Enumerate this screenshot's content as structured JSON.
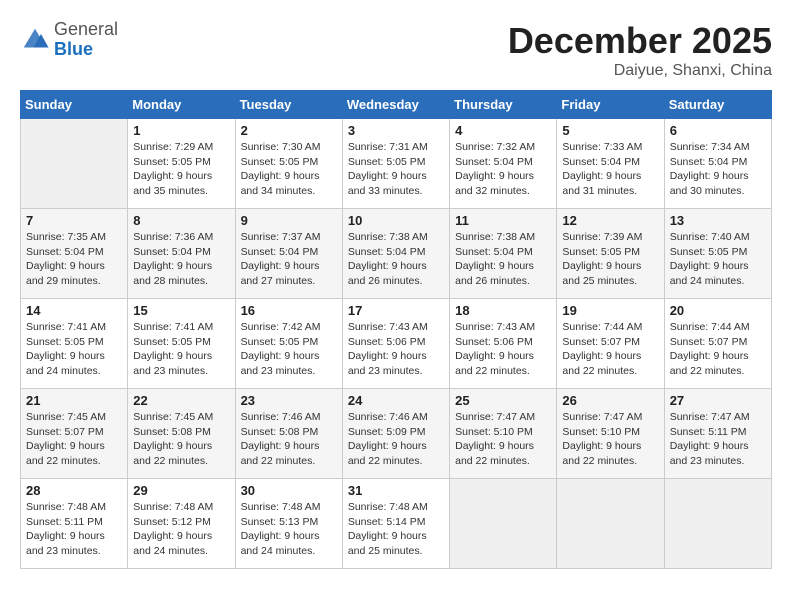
{
  "header": {
    "logo_general": "General",
    "logo_blue": "Blue",
    "month_year": "December 2025",
    "location": "Daiyue, Shanxi, China"
  },
  "days_of_week": [
    "Sunday",
    "Monday",
    "Tuesday",
    "Wednesday",
    "Thursday",
    "Friday",
    "Saturday"
  ],
  "weeks": [
    [
      {
        "day": "",
        "sunrise": "",
        "sunset": "",
        "daylight": "",
        "empty": true
      },
      {
        "day": "1",
        "sunrise": "Sunrise: 7:29 AM",
        "sunset": "Sunset: 5:05 PM",
        "daylight": "Daylight: 9 hours and 35 minutes."
      },
      {
        "day": "2",
        "sunrise": "Sunrise: 7:30 AM",
        "sunset": "Sunset: 5:05 PM",
        "daylight": "Daylight: 9 hours and 34 minutes."
      },
      {
        "day": "3",
        "sunrise": "Sunrise: 7:31 AM",
        "sunset": "Sunset: 5:05 PM",
        "daylight": "Daylight: 9 hours and 33 minutes."
      },
      {
        "day": "4",
        "sunrise": "Sunrise: 7:32 AM",
        "sunset": "Sunset: 5:04 PM",
        "daylight": "Daylight: 9 hours and 32 minutes."
      },
      {
        "day": "5",
        "sunrise": "Sunrise: 7:33 AM",
        "sunset": "Sunset: 5:04 PM",
        "daylight": "Daylight: 9 hours and 31 minutes."
      },
      {
        "day": "6",
        "sunrise": "Sunrise: 7:34 AM",
        "sunset": "Sunset: 5:04 PM",
        "daylight": "Daylight: 9 hours and 30 minutes."
      }
    ],
    [
      {
        "day": "7",
        "sunrise": "Sunrise: 7:35 AM",
        "sunset": "Sunset: 5:04 PM",
        "daylight": "Daylight: 9 hours and 29 minutes."
      },
      {
        "day": "8",
        "sunrise": "Sunrise: 7:36 AM",
        "sunset": "Sunset: 5:04 PM",
        "daylight": "Daylight: 9 hours and 28 minutes."
      },
      {
        "day": "9",
        "sunrise": "Sunrise: 7:37 AM",
        "sunset": "Sunset: 5:04 PM",
        "daylight": "Daylight: 9 hours and 27 minutes."
      },
      {
        "day": "10",
        "sunrise": "Sunrise: 7:38 AM",
        "sunset": "Sunset: 5:04 PM",
        "daylight": "Daylight: 9 hours and 26 minutes."
      },
      {
        "day": "11",
        "sunrise": "Sunrise: 7:38 AM",
        "sunset": "Sunset: 5:04 PM",
        "daylight": "Daylight: 9 hours and 26 minutes."
      },
      {
        "day": "12",
        "sunrise": "Sunrise: 7:39 AM",
        "sunset": "Sunset: 5:05 PM",
        "daylight": "Daylight: 9 hours and 25 minutes."
      },
      {
        "day": "13",
        "sunrise": "Sunrise: 7:40 AM",
        "sunset": "Sunset: 5:05 PM",
        "daylight": "Daylight: 9 hours and 24 minutes."
      }
    ],
    [
      {
        "day": "14",
        "sunrise": "Sunrise: 7:41 AM",
        "sunset": "Sunset: 5:05 PM",
        "daylight": "Daylight: 9 hours and 24 minutes."
      },
      {
        "day": "15",
        "sunrise": "Sunrise: 7:41 AM",
        "sunset": "Sunset: 5:05 PM",
        "daylight": "Daylight: 9 hours and 23 minutes."
      },
      {
        "day": "16",
        "sunrise": "Sunrise: 7:42 AM",
        "sunset": "Sunset: 5:05 PM",
        "daylight": "Daylight: 9 hours and 23 minutes."
      },
      {
        "day": "17",
        "sunrise": "Sunrise: 7:43 AM",
        "sunset": "Sunset: 5:06 PM",
        "daylight": "Daylight: 9 hours and 23 minutes."
      },
      {
        "day": "18",
        "sunrise": "Sunrise: 7:43 AM",
        "sunset": "Sunset: 5:06 PM",
        "daylight": "Daylight: 9 hours and 22 minutes."
      },
      {
        "day": "19",
        "sunrise": "Sunrise: 7:44 AM",
        "sunset": "Sunset: 5:07 PM",
        "daylight": "Daylight: 9 hours and 22 minutes."
      },
      {
        "day": "20",
        "sunrise": "Sunrise: 7:44 AM",
        "sunset": "Sunset: 5:07 PM",
        "daylight": "Daylight: 9 hours and 22 minutes."
      }
    ],
    [
      {
        "day": "21",
        "sunrise": "Sunrise: 7:45 AM",
        "sunset": "Sunset: 5:07 PM",
        "daylight": "Daylight: 9 hours and 22 minutes."
      },
      {
        "day": "22",
        "sunrise": "Sunrise: 7:45 AM",
        "sunset": "Sunset: 5:08 PM",
        "daylight": "Daylight: 9 hours and 22 minutes."
      },
      {
        "day": "23",
        "sunrise": "Sunrise: 7:46 AM",
        "sunset": "Sunset: 5:08 PM",
        "daylight": "Daylight: 9 hours and 22 minutes."
      },
      {
        "day": "24",
        "sunrise": "Sunrise: 7:46 AM",
        "sunset": "Sunset: 5:09 PM",
        "daylight": "Daylight: 9 hours and 22 minutes."
      },
      {
        "day": "25",
        "sunrise": "Sunrise: 7:47 AM",
        "sunset": "Sunset: 5:10 PM",
        "daylight": "Daylight: 9 hours and 22 minutes."
      },
      {
        "day": "26",
        "sunrise": "Sunrise: 7:47 AM",
        "sunset": "Sunset: 5:10 PM",
        "daylight": "Daylight: 9 hours and 22 minutes."
      },
      {
        "day": "27",
        "sunrise": "Sunrise: 7:47 AM",
        "sunset": "Sunset: 5:11 PM",
        "daylight": "Daylight: 9 hours and 23 minutes."
      }
    ],
    [
      {
        "day": "28",
        "sunrise": "Sunrise: 7:48 AM",
        "sunset": "Sunset: 5:11 PM",
        "daylight": "Daylight: 9 hours and 23 minutes."
      },
      {
        "day": "29",
        "sunrise": "Sunrise: 7:48 AM",
        "sunset": "Sunset: 5:12 PM",
        "daylight": "Daylight: 9 hours and 24 minutes."
      },
      {
        "day": "30",
        "sunrise": "Sunrise: 7:48 AM",
        "sunset": "Sunset: 5:13 PM",
        "daylight": "Daylight: 9 hours and 24 minutes."
      },
      {
        "day": "31",
        "sunrise": "Sunrise: 7:48 AM",
        "sunset": "Sunset: 5:14 PM",
        "daylight": "Daylight: 9 hours and 25 minutes."
      },
      {
        "day": "",
        "sunrise": "",
        "sunset": "",
        "daylight": "",
        "empty": true
      },
      {
        "day": "",
        "sunrise": "",
        "sunset": "",
        "daylight": "",
        "empty": true
      },
      {
        "day": "",
        "sunrise": "",
        "sunset": "",
        "daylight": "",
        "empty": true
      }
    ]
  ]
}
